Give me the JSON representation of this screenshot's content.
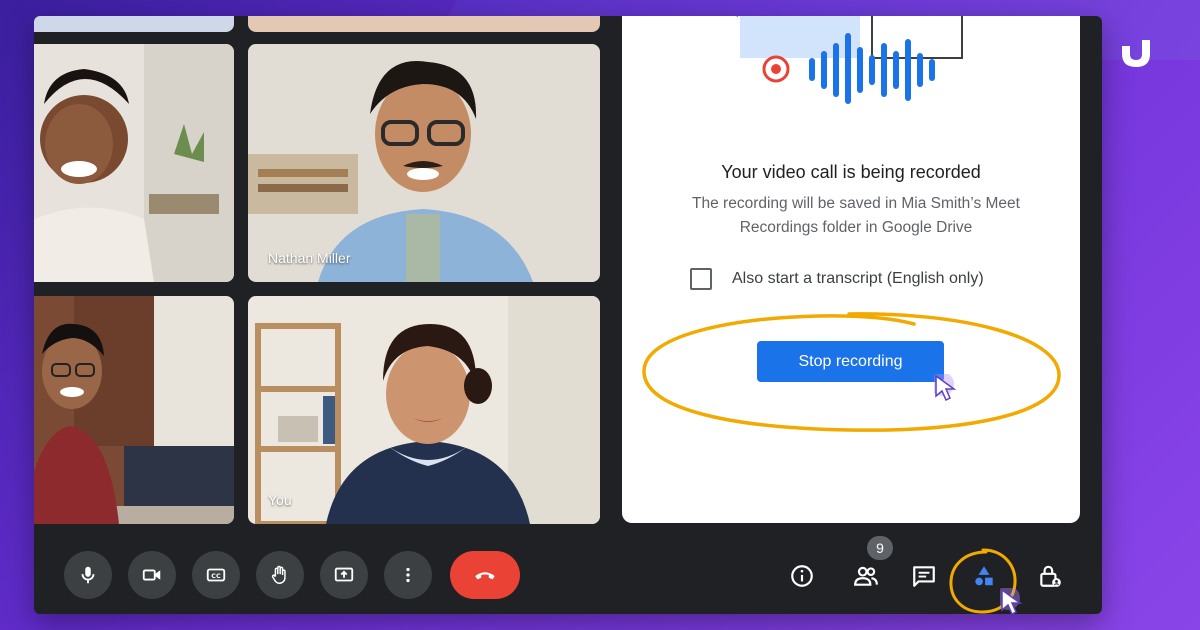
{
  "participants": [
    {
      "name": ""
    },
    {
      "name": "Nathan Miller"
    },
    {
      "name": ""
    },
    {
      "name": "You"
    }
  ],
  "recording_panel": {
    "title": "Your video call is being recorded",
    "description": "The recording will be saved in Mia Smith’s Meet Recordings folder in Google Drive",
    "transcript_label": "Also start a transcript (English only)",
    "transcript_checked": false,
    "stop_button_label": "Stop recording"
  },
  "toolbar": {
    "people_count": "9",
    "controls": [
      "microphone-icon",
      "camera-icon",
      "captions-icon",
      "raise-hand-icon",
      "present-screen-icon",
      "more-options-icon",
      "end-call-icon"
    ],
    "right_icons": [
      "info-icon",
      "people-icon",
      "chat-icon",
      "activities-icon",
      "host-controls-icon"
    ]
  },
  "colors": {
    "primary_blue": "#1a73e8",
    "end_call_red": "#ea4335",
    "annotation_orange": "#f2a900",
    "wave_blue": "#1a73e8",
    "record_red": "#ea4335"
  }
}
